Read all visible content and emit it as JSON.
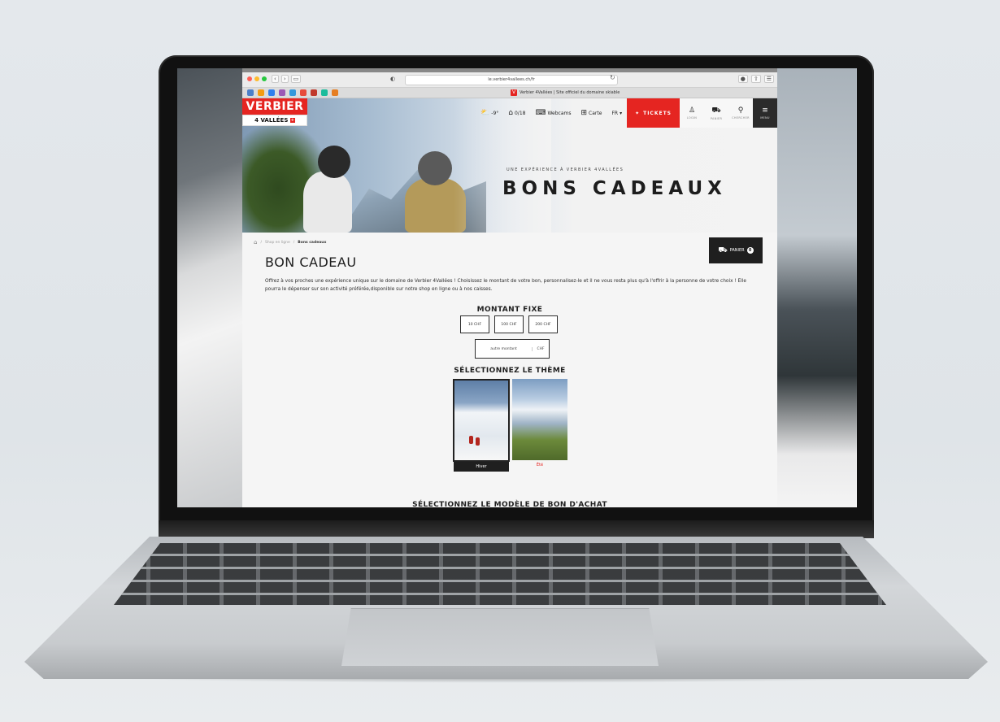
{
  "browser": {
    "url": "le.verbier4vallees.ch/fr",
    "tab_title": "Verbier 4Vallées | Site officiel du domaine skiable",
    "tab_favicon": "V"
  },
  "logo": {
    "top": "VERBIER",
    "bottom": "4 VALLÉES"
  },
  "nav": {
    "weather": "-9°",
    "snow": "0/18",
    "webcams": "Webcams",
    "map": "Carte",
    "lang": "FR",
    "tickets": "TICKETS",
    "login": "LOGIN",
    "cart": "PANIER",
    "search": "CHERCHER",
    "menu": "MENU"
  },
  "hero": {
    "subtitle": "UNE EXPÉRIENCE À VERBIER 4VALLÉES",
    "title": "BONS CADEAUX"
  },
  "breadcrumb": {
    "parent": "Shop en ligne",
    "current": "Bons cadeaux"
  },
  "cart_button": {
    "label": "PANIER",
    "count": "0"
  },
  "page": {
    "title": "BON CADEAU",
    "intro": "Offrez à vos proches une expérience unique sur le domaine de Verbier 4Vallées ! Choisissez le montant de votre bon, personnalisez-le et il ne vous resta plus qu'à l'offrir à la personne de votre choix ! Elle pourra le dépenser sur son activité préférée,disponible sur notre shop en ligne ou à nos caisses."
  },
  "amount_section": {
    "title": "MONTANT FIXE",
    "options": [
      "10 CHF",
      "100 CHF",
      "200 CHF"
    ],
    "other_placeholder": "autre montant",
    "currency": "CHF"
  },
  "theme_section": {
    "title": "SÉLECTIONNEZ LE THÈME",
    "themes": [
      {
        "label": "Hiver",
        "selected": true
      },
      {
        "label": "Été",
        "selected": false
      }
    ]
  },
  "model_section": {
    "title": "SÉLECTIONNEZ LE MODÈLE DE BON D'ACHAT"
  },
  "colors": {
    "brand_red": "#e52521",
    "dark": "#1f1f1f"
  }
}
